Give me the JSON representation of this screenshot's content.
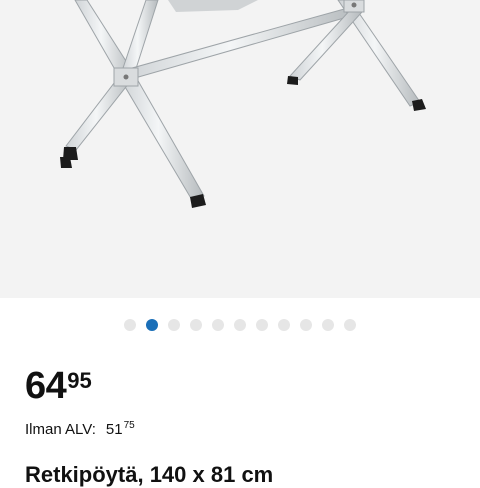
{
  "product": {
    "image_alt": "folding camping table legs",
    "gallery": {
      "image_count": 11,
      "active_index": 1
    },
    "price": {
      "integer": "64",
      "decimals": "95"
    },
    "vat": {
      "label": "Ilman ALV:",
      "integer": "51",
      "decimals": "75"
    },
    "title": "Retkipöytä, 140 x 81 cm"
  },
  "colors": {
    "accent": "#1a6fb8",
    "dot_inactive": "#e6e6e6",
    "image_background": "#f3f3f3"
  }
}
